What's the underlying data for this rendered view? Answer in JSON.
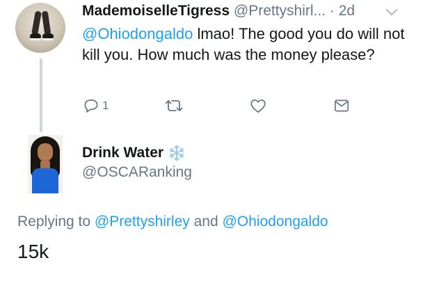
{
  "tweet1": {
    "display_name": "MademoiselleTigress",
    "handle": "@Prettyshirl...",
    "separator": " · ",
    "time": "2d",
    "mention": "@Ohiodongaldo",
    "text_rest": " lmao! The good you do will not kill you. How much was the money please?",
    "reply_count": "1"
  },
  "tweet2": {
    "display_name": "Drink Water",
    "handle": "@OSCARanking",
    "replying_prefix": "Replying to ",
    "replying_user1": "@Prettyshirley",
    "replying_and": " and ",
    "replying_user2": "@Ohiodongaldo",
    "text": "15k"
  },
  "icons": {
    "reply": "reply-icon",
    "retweet": "retweet-icon",
    "like": "heart-icon",
    "dm": "envelope-icon",
    "more": "chevron-down-icon",
    "name_emoji": "snowflake-icon"
  },
  "colors": {
    "link": "#1da1f2",
    "secondary": "#657786",
    "icon": "#657786",
    "thread_line": "#ccd6dd"
  }
}
